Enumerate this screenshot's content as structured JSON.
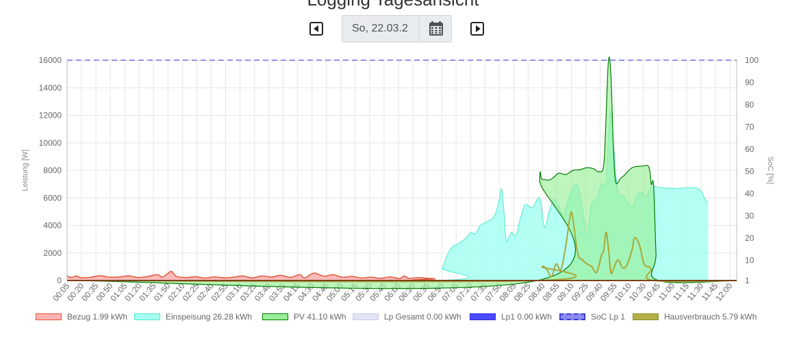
{
  "header": {
    "title": "Logging Tagesansicht",
    "date_value": "So, 22.03.2"
  },
  "icons": {
    "prev": "caret-left-square-icon",
    "calendar": "calendar-icon",
    "next": "caret-right-square-icon"
  },
  "colors": {
    "bezug_fill": "#ffb3b3",
    "bezug_line": "#e0573a",
    "einspeisung_fill": "#a6fff2",
    "einspeisung_line": "#54e8c8",
    "pv_fill": "#99f099",
    "pv_line": "#007a00",
    "lp_gesamt": "#dfe0f5",
    "lp1": "#4b4bff",
    "soc": "#6f6fe6",
    "hausverbrauch_fill": "#b0b045",
    "hausverbrauch_line": "#a8a83a"
  },
  "chart_data": {
    "type": "area",
    "ylabel": "Leistung [W]",
    "y2label": "SoC [%]",
    "ylim": [
      0,
      16000
    ],
    "y_ticks": [
      "0",
      "2000",
      "4000",
      "6000",
      "8000",
      "10000",
      "12000",
      "14000",
      "16000"
    ],
    "y2lim": [
      1,
      100
    ],
    "y2_ticks": [
      "1",
      "10",
      "20",
      "30",
      "40",
      "50",
      "60",
      "70",
      "80",
      "90",
      "100"
    ],
    "grid": true,
    "legend_position": "bottom",
    "x_ticks": [
      "00:05",
      "00:20",
      "00:35",
      "00:50",
      "01:05",
      "01:20",
      "01:35",
      "01:50",
      "02:10",
      "02:25",
      "02:40",
      "02:55",
      "03:10",
      "03:25",
      "03:40",
      "03:55",
      "04:15",
      "04:30",
      "04:45",
      "05:00",
      "05:15",
      "05:30",
      "05:45",
      "06:00",
      "06:20",
      "06:35",
      "06:50",
      "07:05",
      "07:20",
      "07:35",
      "07:50",
      "08:05",
      "08:25",
      "08:40",
      "08:55",
      "09:10",
      "09:25",
      "09:40",
      "09:55",
      "10:10",
      "10:30",
      "10:45",
      "11:00",
      "11:15",
      "11:30",
      "11:45",
      "12:00"
    ],
    "series": [
      {
        "name": "Bezug 1.99 kWh",
        "points": [
          [
            0,
            330
          ],
          [
            2,
            220
          ],
          [
            4,
            330
          ],
          [
            6,
            200
          ],
          [
            10,
            240
          ],
          [
            14,
            350
          ],
          [
            18,
            240
          ],
          [
            22,
            260
          ],
          [
            26,
            340
          ],
          [
            30,
            220
          ],
          [
            34,
            300
          ],
          [
            38,
            430
          ],
          [
            40,
            250
          ],
          [
            42,
            460
          ],
          [
            44,
            660
          ],
          [
            46,
            300
          ],
          [
            50,
            220
          ],
          [
            54,
            280
          ],
          [
            58,
            180
          ],
          [
            62,
            260
          ],
          [
            66,
            200
          ],
          [
            70,
            240
          ],
          [
            74,
            330
          ],
          [
            78,
            190
          ],
          [
            82,
            330
          ],
          [
            86,
            250
          ],
          [
            90,
            380
          ],
          [
            94,
            230
          ],
          [
            98,
            430
          ],
          [
            100,
            200
          ],
          [
            104,
            540
          ],
          [
            108,
            320
          ],
          [
            112,
            420
          ],
          [
            116,
            240
          ],
          [
            120,
            300
          ],
          [
            124,
            180
          ],
          [
            128,
            240
          ],
          [
            132,
            160
          ],
          [
            136,
            260
          ],
          [
            140,
            150
          ],
          [
            142,
            320
          ],
          [
            144,
            160
          ],
          [
            148,
            210
          ],
          [
            152,
            160
          ],
          [
            155,
            120
          ],
          [
            156,
            0
          ],
          [
            282,
            0
          ]
        ]
      },
      {
        "name": "Einspeisung 26.28 kWh",
        "points": [
          [
            0,
            0
          ],
          [
            156,
            0
          ],
          [
            158,
            900
          ],
          [
            160,
            1800
          ],
          [
            162,
            2400
          ],
          [
            165,
            2700
          ],
          [
            168,
            3100
          ],
          [
            170,
            3500
          ],
          [
            172,
            3400
          ],
          [
            174,
            4000
          ],
          [
            177,
            4300
          ],
          [
            180,
            4700
          ],
          [
            182,
            5900
          ],
          [
            183,
            6650
          ],
          [
            184,
            5000
          ],
          [
            185,
            2900
          ],
          [
            187,
            3500
          ],
          [
            189,
            3300
          ],
          [
            191,
            4600
          ],
          [
            193,
            5500
          ],
          [
            196,
            5300
          ],
          [
            199,
            6000
          ],
          [
            201,
            3900
          ],
          [
            203,
            5000
          ],
          [
            205,
            5900
          ],
          [
            207,
            5400
          ],
          [
            209,
            4800
          ],
          [
            211,
            5800
          ],
          [
            213,
            6700
          ],
          [
            215,
            6900
          ],
          [
            217,
            5200
          ],
          [
            219,
            3400
          ],
          [
            221,
            5600
          ],
          [
            223,
            5900
          ],
          [
            225,
            7000
          ],
          [
            227,
            7200
          ],
          [
            228,
            10500
          ],
          [
            229,
            12300
          ],
          [
            230,
            10000
          ],
          [
            232,
            6400
          ],
          [
            234,
            6200
          ],
          [
            236,
            5700
          ],
          [
            238,
            5300
          ],
          [
            240,
            6200
          ],
          [
            242,
            6400
          ],
          [
            244,
            6100
          ],
          [
            246,
            6800
          ],
          [
            250,
            6750
          ],
          [
            254,
            6700
          ],
          [
            258,
            6700
          ],
          [
            262,
            6750
          ],
          [
            265,
            6700
          ],
          [
            267,
            6500
          ],
          [
            269,
            5800
          ],
          [
            270,
            5800
          ]
        ]
      },
      {
        "name": "PV 41.10 kWh",
        "points": [
          [
            0,
            0
          ],
          [
            198,
            0
          ],
          [
            199,
            7300
          ],
          [
            200,
            7350
          ],
          [
            203,
            7300
          ],
          [
            205,
            7500
          ],
          [
            207,
            7800
          ],
          [
            210,
            7700
          ],
          [
            213,
            8000
          ],
          [
            216,
            8050
          ],
          [
            219,
            8200
          ],
          [
            222,
            8100
          ],
          [
            224,
            7900
          ],
          [
            226,
            8400
          ],
          [
            227,
            12000
          ],
          [
            228,
            16000
          ],
          [
            229,
            15000
          ],
          [
            230,
            10000
          ],
          [
            231,
            7200
          ],
          [
            233,
            7400
          ],
          [
            235,
            7700
          ],
          [
            238,
            8200
          ],
          [
            242,
            8300
          ],
          [
            245,
            8250
          ],
          [
            246,
            7000
          ],
          [
            247,
            6900
          ],
          [
            248,
            2000
          ],
          [
            249,
            0
          ],
          [
            282,
            0
          ]
        ]
      },
      {
        "name": "Lp Gesamt 0.00 kWh",
        "points": [
          [
            0,
            0
          ],
          [
            282,
            0
          ]
        ]
      },
      {
        "name": "Lp1 0.00 kWh",
        "points": [
          [
            0,
            0
          ],
          [
            282,
            0
          ]
        ]
      },
      {
        "name": "SoC Lp 1",
        "axis": "y2",
        "points": [
          [
            0,
            100
          ],
          [
            282,
            100
          ]
        ]
      },
      {
        "name": "Hausverbrauch 5.79 kWh",
        "points": [
          [
            0,
            0
          ],
          [
            198,
            0
          ],
          [
            200,
            1000
          ],
          [
            202,
            800
          ],
          [
            204,
            300
          ],
          [
            206,
            1200
          ],
          [
            208,
            800
          ],
          [
            210,
            2500
          ],
          [
            212,
            4800
          ],
          [
            213,
            4500
          ],
          [
            215,
            2000
          ],
          [
            217,
            1500
          ],
          [
            219,
            1200
          ],
          [
            221,
            1000
          ],
          [
            223,
            600
          ],
          [
            225,
            1800
          ],
          [
            226,
            2200
          ],
          [
            227,
            3500
          ],
          [
            228,
            2300
          ],
          [
            229,
            600
          ],
          [
            230,
            800
          ],
          [
            232,
            1500
          ],
          [
            234,
            900
          ],
          [
            236,
            1200
          ],
          [
            238,
            2300
          ],
          [
            239,
            3100
          ],
          [
            241,
            2600
          ],
          [
            243,
            1200
          ],
          [
            245,
            1000
          ],
          [
            246,
            800
          ],
          [
            247,
            0
          ],
          [
            282,
            0
          ]
        ]
      }
    ],
    "x_domain": [
      0,
      282
    ]
  },
  "legend": [
    {
      "label": "Bezug 1.99 kWh",
      "fill": "#ffb3b3",
      "line": "#e0573a",
      "dashed": false
    },
    {
      "label": "Einspeisung 26.28 kWh",
      "fill": "#a6fff2",
      "line": "#54e8c8",
      "dashed": false
    },
    {
      "label": "PV 41.10 kWh",
      "fill": "#99f099",
      "line": "#007a00",
      "dashed": false
    },
    {
      "label": "Lp Gesamt 0.00 kWh",
      "fill": "#e3e4f5",
      "line": "#c9cbef",
      "dashed": false
    },
    {
      "label": "Lp1 0.00 kWh",
      "fill": "#4b4bff",
      "line": "#2c2cdd",
      "dashed": false
    },
    {
      "label": "SoC Lp 1",
      "fill": "#8a8af0",
      "line": "#3a3ad0",
      "dashed": true
    },
    {
      "label": "Hausverbrauch 5.79 kWh",
      "fill": "#b0b045",
      "line": "#8e8e2e",
      "dashed": false
    }
  ]
}
